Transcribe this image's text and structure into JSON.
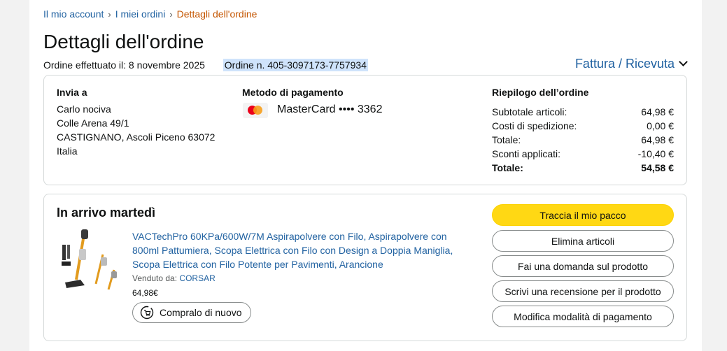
{
  "breadcrumb": {
    "my_account": "Il mio account",
    "my_orders": "I miei ordini",
    "current": "Dettagli dell'ordine",
    "separator": "›"
  },
  "header": {
    "title": "Dettagli dell'ordine",
    "order_date": "Ordine effettuato il: 8 novembre 2025",
    "order_number": "Ordine n. 405-3097173-7757934",
    "invoice_label": "Fattura / Ricevuta"
  },
  "shipping": {
    "heading": "Invia a",
    "name": "Carlo nociva",
    "street": "Colle Arena 49/1",
    "city": "CASTIGNANO, Ascoli Piceno 63072",
    "country": "Italia"
  },
  "payment": {
    "heading": "Metodo di pagamento",
    "card": "MasterCard •••• 3362",
    "icon": "mastercard-icon"
  },
  "summary": {
    "heading": "Riepilogo dell’ordine",
    "rows": [
      {
        "label": "Subtotale articoli:",
        "value": "64,98 €"
      },
      {
        "label": "Costi di spedizione:",
        "value": "0,00 €"
      },
      {
        "label": "Totale:",
        "value": "64,98 €"
      },
      {
        "label": "Sconti applicati:",
        "value": "-10,40 €"
      },
      {
        "label": "Totale:",
        "value": "54,58 €"
      }
    ]
  },
  "shipment": {
    "arrival": "In arrivo martedì",
    "product_title": "VACTechPro 60KPa/600W/7M Aspirapolvere con Filo, Aspirapolvere con 800ml Pattumiera, Scopa Elettrica con Filo con Design a Doppia Maniglia, Scopa Elettrica con Filo Potente per Pavimenti, Arancione",
    "sold_by_label": "Venduto da:",
    "seller": "CORSAR",
    "price": "64,98€",
    "rebuy_label": "Compralo di nuovo"
  },
  "actions": {
    "track": "Traccia il mio pacco",
    "delete": "Elimina articoli",
    "question": "Fai una domanda sul prodotto",
    "review": "Scrivi una recensione per il prodotto",
    "change_payment": "Modifica modalità di pagamento"
  },
  "colors": {
    "link": "#2162a1",
    "breadcrumb_current": "#c45500",
    "primary_button": "#ffd814",
    "highlight": "#cfe3fb"
  }
}
